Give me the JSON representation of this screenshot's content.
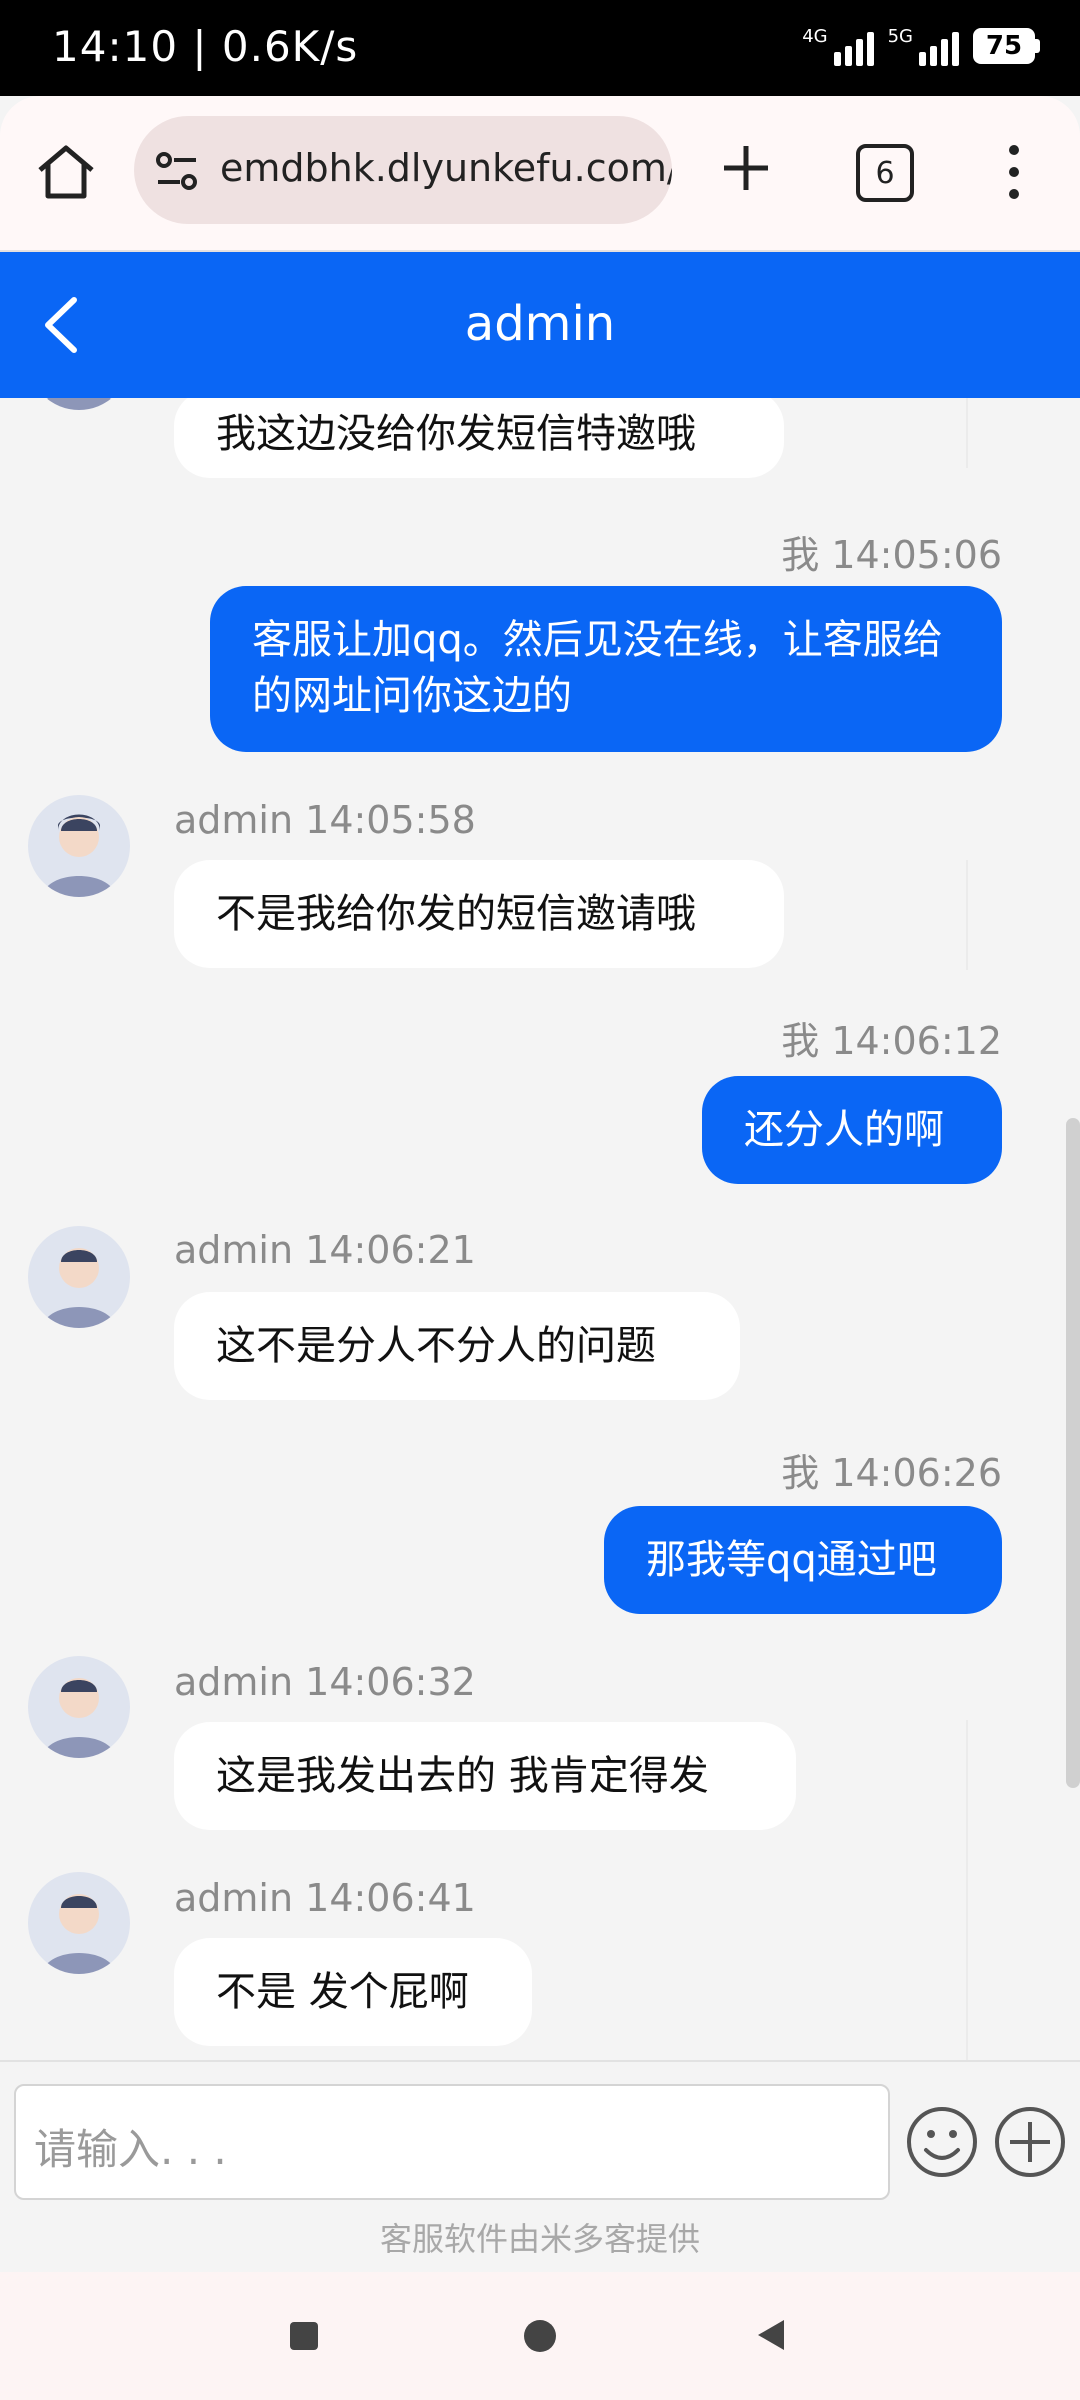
{
  "status_bar": {
    "time": "14:10 | 0.6K/s",
    "signal_labels": [
      "4G",
      "5G"
    ],
    "battery": "75"
  },
  "browser": {
    "url": "emdbhk.dlyunkefu.com/v",
    "tab_count": "6"
  },
  "header": {
    "title": "admin"
  },
  "messages": [
    {
      "side": "in",
      "text": "我这边没给你发短信特邀哦"
    },
    {
      "side": "out",
      "meta": "我 14:05:06",
      "text": "客服让加qq。然后见没在线，让客服给的网址问你这边的"
    },
    {
      "side": "in",
      "meta": "admin 14:05:58",
      "text": "不是我给你发的短信邀请哦"
    },
    {
      "side": "out",
      "meta": "我 14:06:12",
      "text": "还分人的啊"
    },
    {
      "side": "in",
      "meta": "admin 14:06:21",
      "text": "这不是分人不分人的问题"
    },
    {
      "side": "out",
      "meta": "我 14:06:26",
      "text": "那我等qq通过吧"
    },
    {
      "side": "in",
      "meta": "admin 14:06:32",
      "text": "这是我发出去的 我肯定得发"
    },
    {
      "side": "in",
      "meta": "admin 14:06:41",
      "text": "不是 发个屁啊"
    }
  ],
  "input": {
    "placeholder": "请输入. . .",
    "powered_by": "客服软件由米多客提供"
  },
  "icons": {
    "home": "home-icon",
    "tune": "tune-icon",
    "add_tab": "plus-icon",
    "tabs": "tabs-icon",
    "menu": "more-vert-icon",
    "back": "chevron-left-icon",
    "emoji": "emoji-icon",
    "add": "add-circle-icon"
  },
  "colors": {
    "accent": "#0a66f5",
    "bubble_in": "#ffffff",
    "background": "#f4f4f4"
  }
}
